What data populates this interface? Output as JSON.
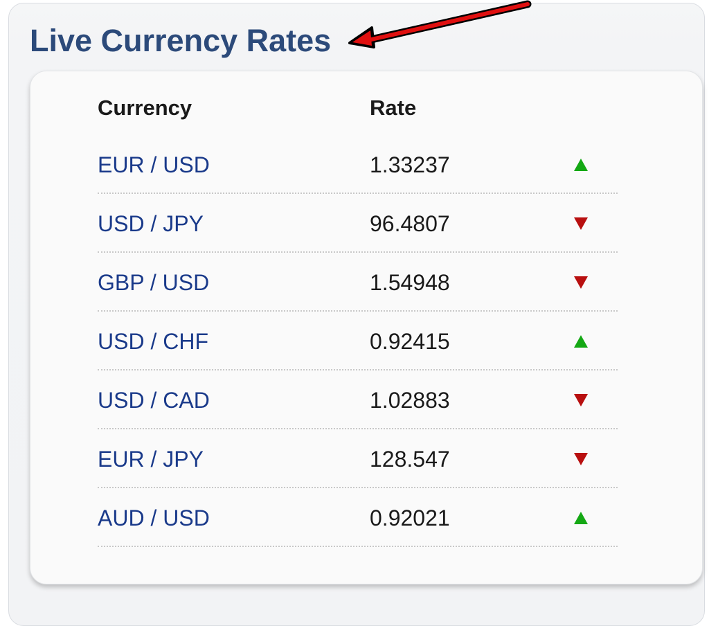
{
  "widget": {
    "title": "Live Currency Rates"
  },
  "table": {
    "headers": {
      "currency": "Currency",
      "rate": "Rate"
    },
    "rows": [
      {
        "pair": "EUR / USD",
        "rate": "1.33237",
        "trend": "up"
      },
      {
        "pair": "USD / JPY",
        "rate": "96.4807",
        "trend": "down"
      },
      {
        "pair": "GBP / USD",
        "rate": "1.54948",
        "trend": "down"
      },
      {
        "pair": "USD / CHF",
        "rate": "0.92415",
        "trend": "up"
      },
      {
        "pair": "USD / CAD",
        "rate": "1.02883",
        "trend": "down"
      },
      {
        "pair": "EUR / JPY",
        "rate": "128.547",
        "trend": "down"
      },
      {
        "pair": "AUD / USD",
        "rate": "0.92021",
        "trend": "up"
      }
    ]
  },
  "icons": {
    "up": "triangle-up-icon",
    "down": "triangle-down-icon",
    "annotation": "red-arrow-icon"
  },
  "colors": {
    "title": "#2c4a7a",
    "pair_text": "#1a3a8a",
    "up": "#14a814",
    "down": "#b80f0f",
    "annotation_arrow": "#e01010"
  }
}
